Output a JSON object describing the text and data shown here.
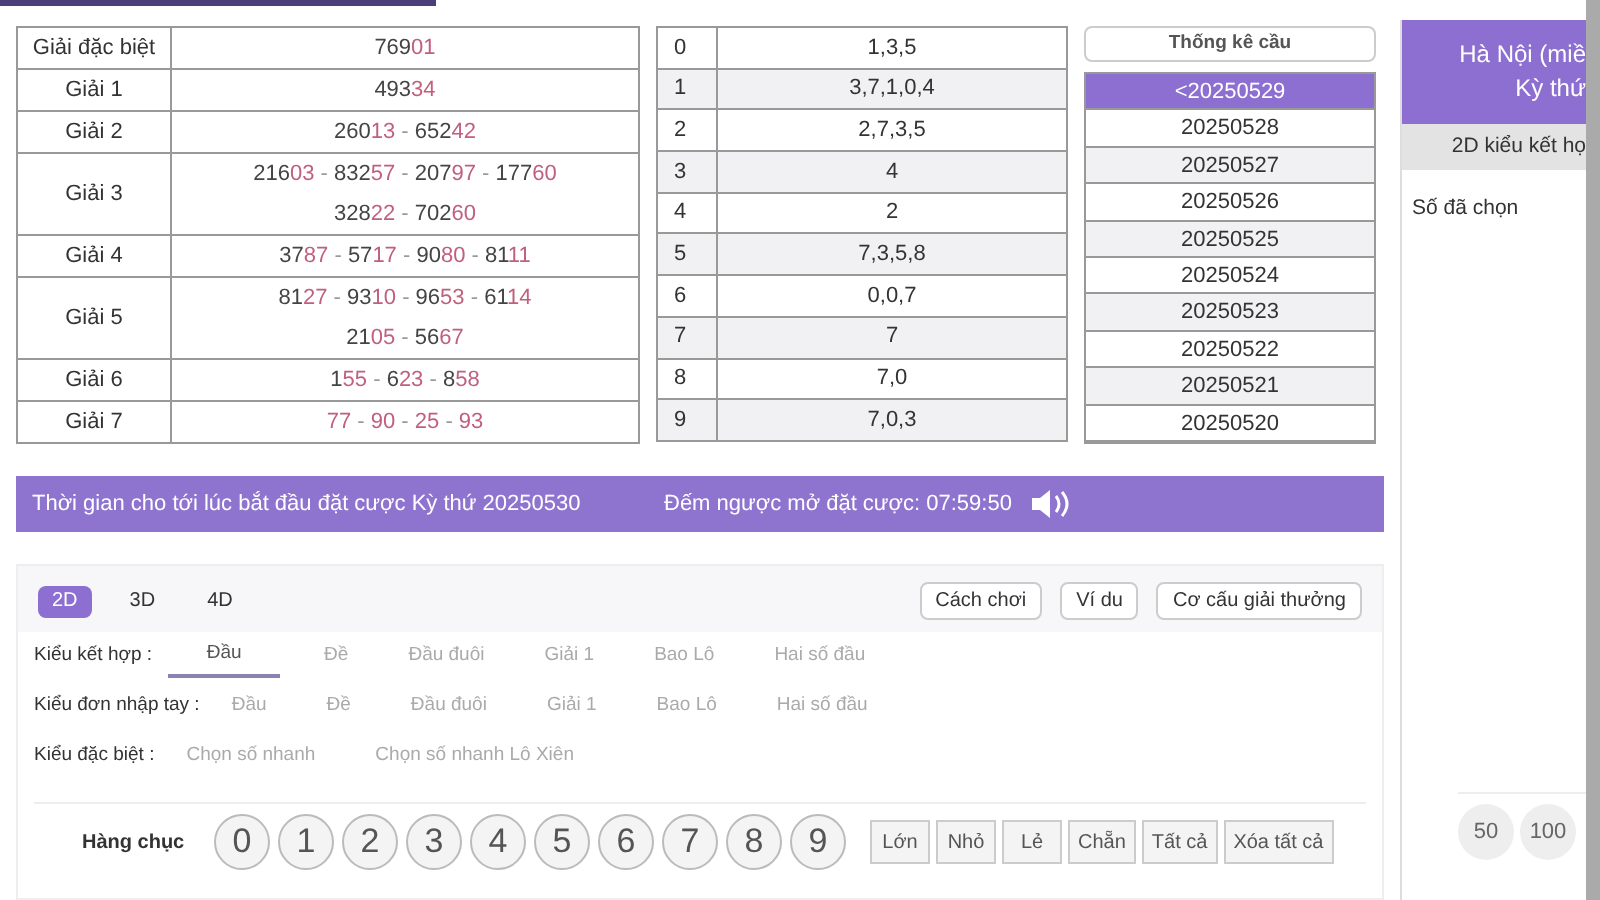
{
  "prizes": [
    {
      "label": "Giải đặc biệt",
      "lines": [
        "76901"
      ]
    },
    {
      "label": "Giải 1",
      "lines": [
        "49334"
      ]
    },
    {
      "label": "Giải 2",
      "lines": [
        "26013 - 65242"
      ]
    },
    {
      "label": "Giải 3",
      "lines": [
        "21603 - 83257 - 20797 - 17760",
        "32822 - 70260"
      ]
    },
    {
      "label": "Giải 4",
      "lines": [
        "3787 - 5717 - 9080 - 8111"
      ]
    },
    {
      "label": "Giải 5",
      "lines": [
        "8127 - 9310 - 9653 - 6114",
        "2105 - 5667"
      ]
    },
    {
      "label": "Giải 6",
      "lines": [
        "155 - 623 - 858"
      ]
    },
    {
      "label": "Giải 7",
      "lines": [
        "77 - 90 - 25 - 93"
      ]
    }
  ],
  "heads": [
    {
      "digit": "0",
      "tails": "1,3,5"
    },
    {
      "digit": "1",
      "tails": "3,7,1,0,4"
    },
    {
      "digit": "2",
      "tails": "2,7,3,5"
    },
    {
      "digit": "3",
      "tails": "4"
    },
    {
      "digit": "4",
      "tails": "2"
    },
    {
      "digit": "5",
      "tails": "7,3,5,8"
    },
    {
      "digit": "6",
      "tails": "0,0,7"
    },
    {
      "digit": "7",
      "tails": "7"
    },
    {
      "digit": "8",
      "tails": "7,0"
    },
    {
      "digit": "9",
      "tails": "7,0,3"
    }
  ],
  "stats": {
    "button": "Thống kê cầu",
    "draws": [
      {
        "label": "<20250529",
        "selected": true
      },
      {
        "label": "20250528",
        "selected": false
      },
      {
        "label": "20250527",
        "selected": false
      },
      {
        "label": "20250526",
        "selected": false
      },
      {
        "label": "20250525",
        "selected": false
      },
      {
        "label": "20250524",
        "selected": false
      },
      {
        "label": "20250523",
        "selected": false
      },
      {
        "label": "20250522",
        "selected": false
      },
      {
        "label": "20250521",
        "selected": false
      },
      {
        "label": "20250520",
        "selected": false
      }
    ]
  },
  "banner": {
    "message": "Thời gian cho tới lúc bắt đầu đặt cược Kỳ thứ 20250530",
    "countdown": "Đếm ngược mở đặt cược: 07:59:50"
  },
  "bet": {
    "modes": [
      {
        "label": "2D",
        "selected": true
      },
      {
        "label": "3D",
        "selected": false
      },
      {
        "label": "4D",
        "selected": false
      }
    ],
    "links": [
      "Cách chơi",
      "Ví du",
      "Cơ cấu giải thưởng"
    ],
    "types": [
      {
        "label": "Kiểu kết hợp :",
        "options": [
          {
            "label": "Đầu",
            "selected": true
          },
          {
            "label": "Đề",
            "selected": false
          },
          {
            "label": "Đầu đuôi",
            "selected": false
          },
          {
            "label": "Giải 1",
            "selected": false
          },
          {
            "label": "Bao Lô",
            "selected": false
          },
          {
            "label": "Hai số đầu",
            "selected": false
          }
        ]
      },
      {
        "label": "Kiểu đơn nhập tay :",
        "options": [
          {
            "label": "Đầu",
            "selected": false
          },
          {
            "label": "Đề",
            "selected": false
          },
          {
            "label": "Đầu đuôi",
            "selected": false
          },
          {
            "label": "Giải 1",
            "selected": false
          },
          {
            "label": "Bao Lô",
            "selected": false
          },
          {
            "label": "Hai số đầu",
            "selected": false
          }
        ]
      },
      {
        "label": "Kiểu đặc biệt :",
        "options": [
          {
            "label": "Chọn số nhanh",
            "selected": false
          },
          {
            "label": "Chọn số nhanh Lô Xiên",
            "selected": false
          }
        ]
      }
    ],
    "picker": {
      "label": "Hàng chục",
      "digits": [
        "0",
        "1",
        "2",
        "3",
        "4",
        "5",
        "6",
        "7",
        "8",
        "9"
      ],
      "quick": [
        "Lớn",
        "Nhỏ",
        "Lẻ",
        "Chẵn",
        "Tất cả",
        "Xóa tất cả"
      ]
    }
  },
  "side": {
    "title": "Hà Nội (miề",
    "subtitle": "Kỳ thứ",
    "tab": "2D kiểu kết họ",
    "selected_label": "Số đã chọn",
    "amounts": [
      "50",
      "100"
    ]
  }
}
